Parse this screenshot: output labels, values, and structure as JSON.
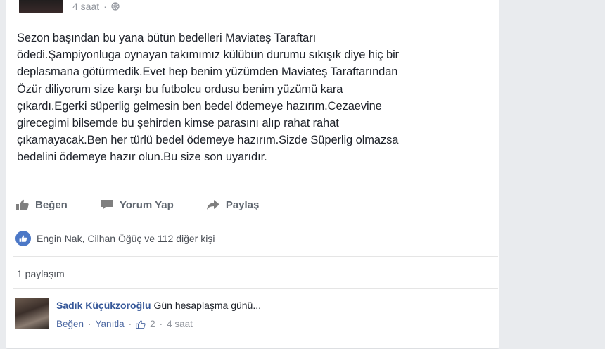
{
  "post": {
    "timestamp": "4 saat",
    "privacy_icon": "globe-icon",
    "lines": [
      "Sezon başından bu yana bütün bedelleri Maviateş Taraftarı",
      "ödedi.Şampiyonluga oynayan takımımız külübün durumu sıkışık diye hiç bir",
      "deplasmana götürmedik.Evet hep benim yüzümden Maviateş Taraftarından",
      "Özür diliyorum size karşı bu futbolcu ordusu benim yüzümü kara",
      "çıkardı.Egerki süperlig gelmesin ben bedel ödemeye hazırım.Cezaevine",
      "girecegimi bilsemde bu şehirden kimse parasını alıp rahat rahat",
      "çıkamayacak.Ben her türlü bedel ödemeye hazırım.Sizde Süperlig olmazsa",
      "bedelini ödemeye hazır olun.Bu size son uyarıdır."
    ]
  },
  "actions": {
    "like_label": "Beğen",
    "comment_label": "Yorum Yap",
    "share_label": "Paylaş"
  },
  "reactions": {
    "text": "Engin Nak, Cilhan Öğüç ve 112 diğer kişi"
  },
  "shares": {
    "text": "1 paylaşım"
  },
  "comment": {
    "author": "Sadık Küçükzoroğlu",
    "text": "Gün hesaplaşma günü...",
    "like_label": "Beğen",
    "sep": "·",
    "reply_label": "Yanıtla",
    "like_count": "2",
    "timestamp": "4 saat"
  },
  "colors": {
    "link": "#365899",
    "muted": "#90949c",
    "like_blue": "#4c78c7"
  }
}
